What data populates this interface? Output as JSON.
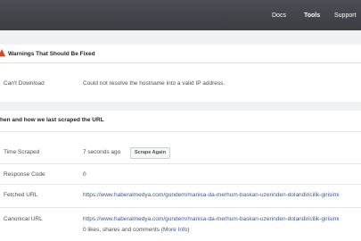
{
  "nav": {
    "docs": "Docs",
    "tools": "Tools",
    "support": "Support"
  },
  "warnings": {
    "title": "Warnings That Should Be Fixed",
    "row_label": "Can't Download",
    "row_value": "Could not resolve the hostname into a valid IP address."
  },
  "scrape": {
    "section_title": "hen and how we last scraped the URL",
    "time_label": "Time Scraped",
    "time_value": "7 seconds ago",
    "scrape_again": "Scrape Again",
    "response_label": "Response Code",
    "response_value": "0",
    "fetched_label": "Fetched URL",
    "fetched_url": "https://www.haberalmedya.com/gundem/manisa-da-merhum-baskan-uzerinden-dolandiricilik-girisimi",
    "canonical_label": "Canonical URL",
    "canonical_url": "https://www.haberalmedya.com/gundem/manisa-da-merhum-baskan-uzerinden-dolandiricilik-girisimi",
    "likes_text": "0 likes, shares and comments (",
    "more_info": "More Info",
    "likes_close": ")"
  }
}
